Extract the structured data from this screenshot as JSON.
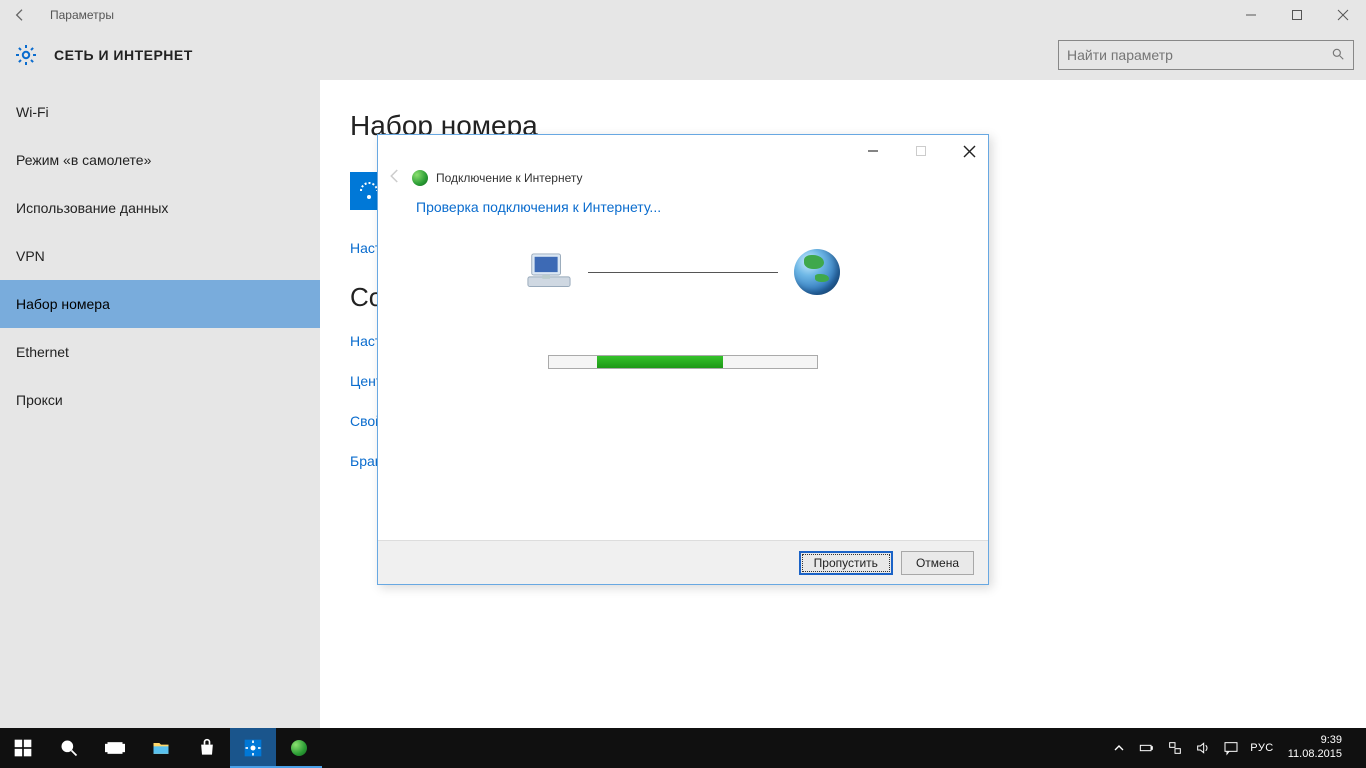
{
  "titlebar": {
    "title": "Параметры"
  },
  "header": {
    "title": "СЕТЬ И ИНТЕРНЕТ"
  },
  "search": {
    "placeholder": "Найти параметр"
  },
  "sidebar": {
    "items": [
      {
        "label": "Wi-Fi"
      },
      {
        "label": "Режим «в самолете»"
      },
      {
        "label": "Использование данных"
      },
      {
        "label": "VPN"
      },
      {
        "label": "Набор номера"
      },
      {
        "label": "Ethernet"
      },
      {
        "label": "Прокси"
      }
    ],
    "selected_index": 4
  },
  "content": {
    "heading1": "Набор номера",
    "link1": "Настр",
    "heading2_partial": "Со",
    "related": {
      "link_a": "Настр",
      "link_b": "Цент",
      "link_c": "Свой",
      "link_d": "Бран"
    }
  },
  "wizard": {
    "title": "Подключение к Интернету",
    "heading": "Проверка подключения к Интернету...",
    "buttons": {
      "skip": "Пропустить",
      "cancel": "Отмена"
    }
  },
  "taskbar": {
    "lang": "РУС",
    "time": "9:39",
    "date": "11.08.2015"
  }
}
